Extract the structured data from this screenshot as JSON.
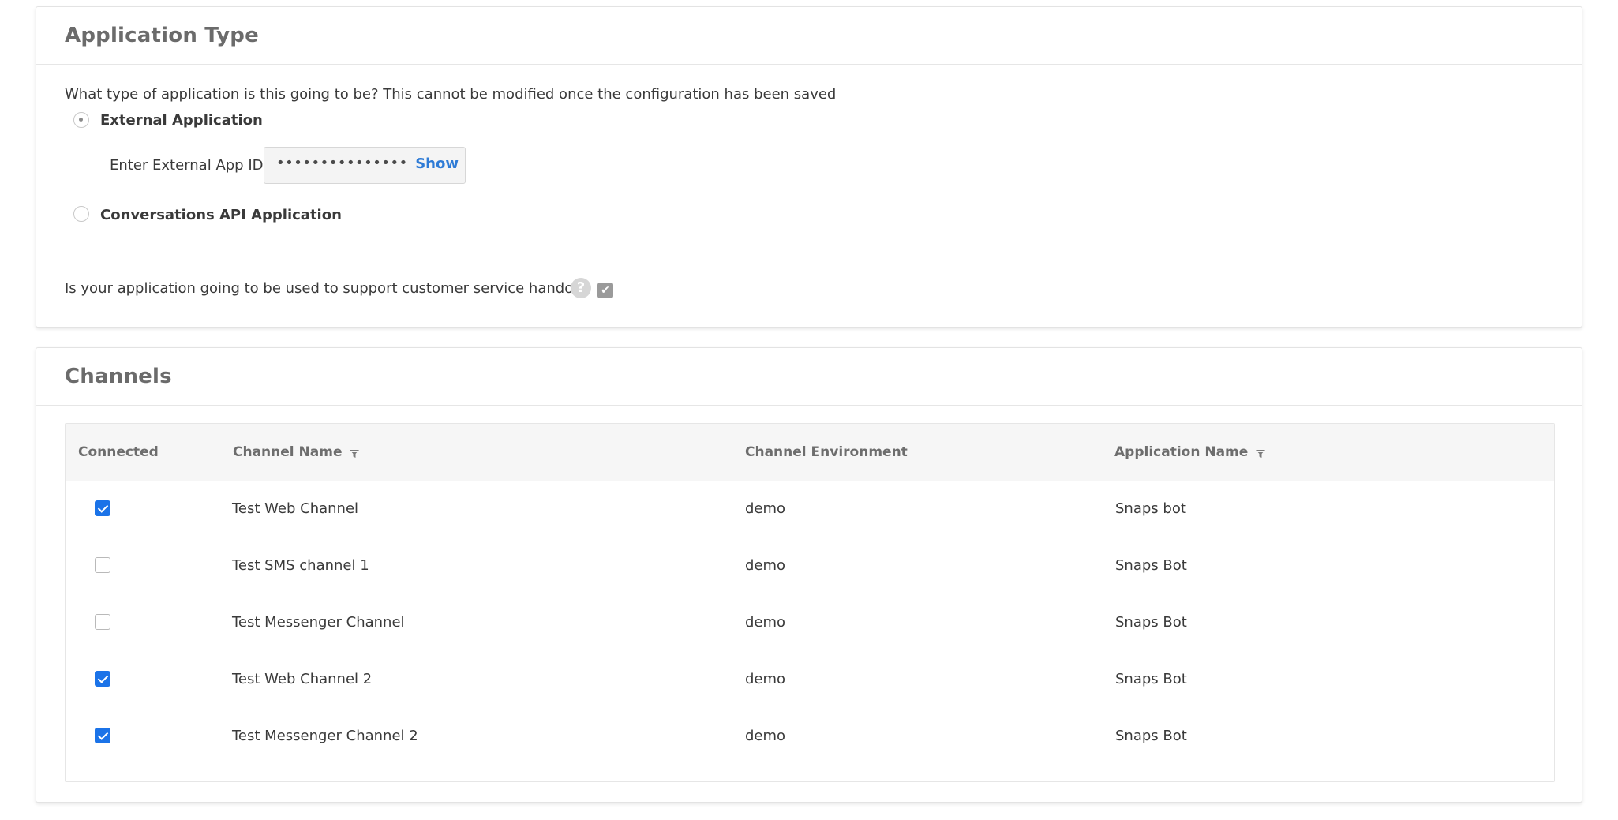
{
  "app_type": {
    "title": "Application Type",
    "question": "What type of application is this going to be? This cannot be modified once the configuration has been saved",
    "option_external": "External Application",
    "external_id_label": "Enter External App ID",
    "external_id_value": "•••••••••••••••",
    "show_label": "Show",
    "option_conversations": "Conversations API Application",
    "handoff_question": "Is your application going to be used to support customer service handoff?",
    "handoff_checked": true,
    "selected_option": "external"
  },
  "channels": {
    "title": "Channels",
    "columns": {
      "connected": "Connected",
      "channel_name": "Channel Name",
      "channel_environment": "Channel Environment",
      "application_name": "Application Name"
    },
    "rows": [
      {
        "connected": true,
        "name": "Test Web Channel",
        "env": "demo",
        "app": "Snaps bot"
      },
      {
        "connected": false,
        "name": "Test SMS channel 1",
        "env": "demo",
        "app": "Snaps Bot"
      },
      {
        "connected": false,
        "name": "Test Messenger Channel",
        "env": "demo",
        "app": "Snaps Bot"
      },
      {
        "connected": true,
        "name": "Test Web Channel 2",
        "env": "demo",
        "app": "Snaps Bot"
      },
      {
        "connected": true,
        "name": "Test Messenger Channel 2",
        "env": "demo",
        "app": "Snaps Bot"
      }
    ]
  },
  "colors": {
    "accent": "#1b73e8",
    "link": "#2e7bd6",
    "title": "#6b6b6b"
  }
}
